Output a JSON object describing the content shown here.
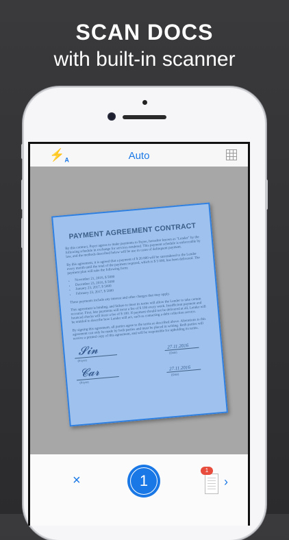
{
  "headline": {
    "title": "SCAN DOCS",
    "subtitle": "with built-in scanner"
  },
  "topbar": {
    "flash_icon": "flash-auto-icon",
    "flash_glyph": "⚡",
    "flash_sub": "A",
    "mode_label": "Auto",
    "grid_icon": "grid-icon"
  },
  "document": {
    "title": "PAYMENT AGREEMENT CONTRACT",
    "para1": "By this contract, Payer agrees to make payments to Payee, hereafter known as \"Lender\" by the following schedule in exchange for services rendered. This payment schedule is enforceable by law, and the methods described below will be use in cases of delinquent payment.",
    "para2": "By this agreement, it is agreed that a payment of $ 20 000 will be surrendered to the Lender every month until the total of the payment required, which is $ 5 000, has been delivered. The payment plan will take the following form:",
    "schedule": [
      "November 21, 2016, $ 5000",
      "December 23, 2016, $ 5000",
      "January 23, 2017, $ 5000",
      "February 23, 2017, $ 5000"
    ],
    "para3": "These payments include any interest and other charges that may apply.",
    "para4": "This agreement is binding, and failure to meet its terms will allow the Lender to take certain recourse. First, late payments will incur a fee of $ 100 every week. Insufficient payment and bounced checks will incur a fee of $ 100. If payment should not be delivered at all, Lender will be entitled to describe how Lender will act, such as contacting a debt collection service.",
    "para5": "By signing this agreement, all parties agree to the terms as described above. Alterations to this agreement can only be made by both parties and must be placed in writing. Both parties will receive a printed copy of this agreement, and will be responsible for upholding its terms.",
    "payer_label": "(Payer)",
    "date_label": "(Date)",
    "date1": "27.11.2016",
    "date2": "27.11.2016"
  },
  "bottombar": {
    "close_glyph": "×",
    "shutter_count": "1",
    "badge_count": "1",
    "next_glyph": "›"
  },
  "colors": {
    "accent": "#1a78e6",
    "badge": "#e74c3c",
    "overlay": "#2f7fe0"
  }
}
